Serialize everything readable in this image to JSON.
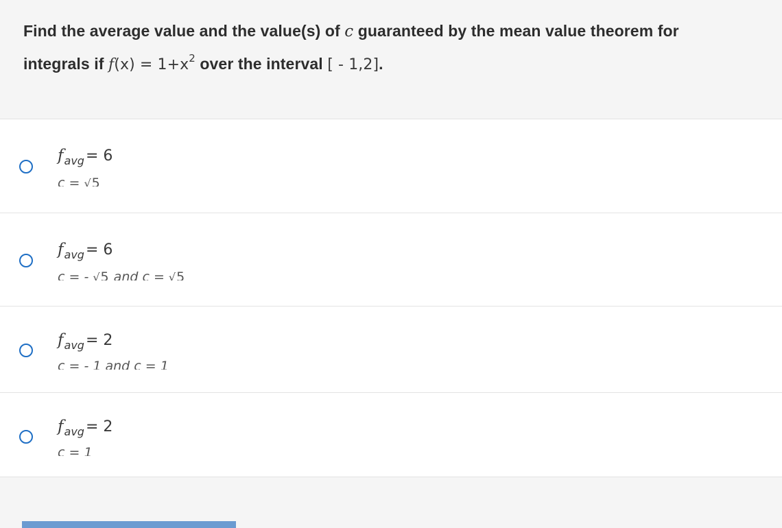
{
  "question": {
    "line1_text": "Find the average value and the value(s) of",
    "line1_var": "c",
    "line1_rest": "guaranteed by the mean value theorem for",
    "line2_text": "integrals if",
    "line2_func": "f(x) = 1+x",
    "line2_exp": "2",
    "line2_mid": "over the interval",
    "line2_interval": "[ - 1,2]",
    "line2_end": "."
  },
  "options": [
    {
      "f_label": "f",
      "f_sub": "avg",
      "f_eq": "= 6",
      "c_text": "c = ",
      "c_parts": [
        "5"
      ],
      "c_and": ""
    },
    {
      "f_label": "f",
      "f_sub": "avg",
      "f_eq": "= 6",
      "c_text": "c = - ",
      "c_parts": [
        "5",
        "5"
      ],
      "c_and": " and c = "
    },
    {
      "f_label": "f",
      "f_sub": "avg",
      "f_eq": "= 2",
      "c_text": "c = - 1 and c = 1"
    },
    {
      "f_label": "f",
      "f_sub": "avg",
      "f_eq": "= 2",
      "c_text": "c = 1"
    }
  ],
  "colors": {
    "radio": "#1f6fc5",
    "button_bar": "#6b9bd1"
  }
}
